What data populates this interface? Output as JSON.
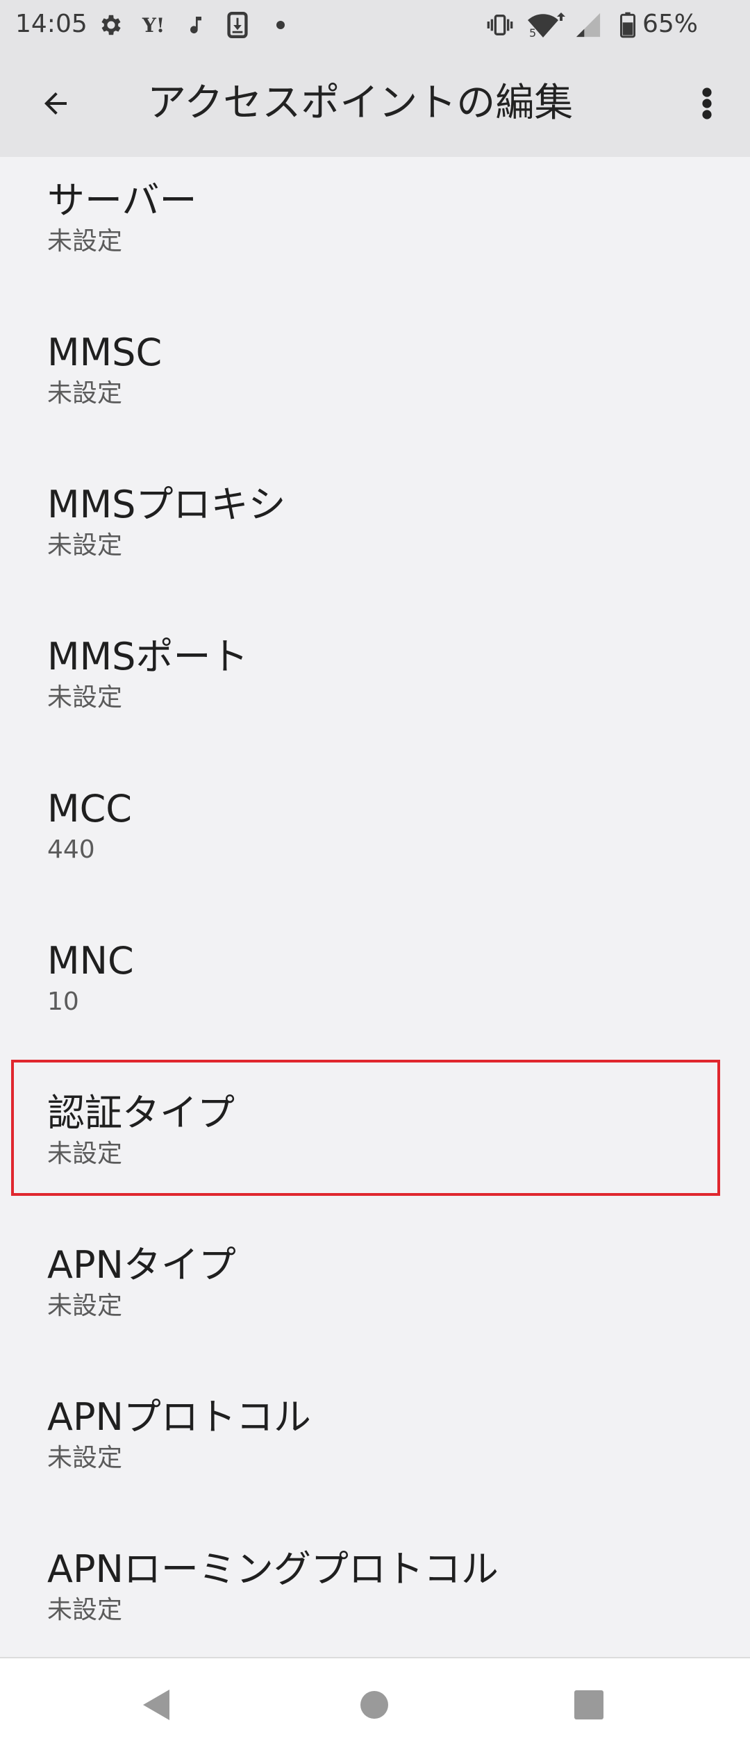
{
  "status_bar": {
    "time": "14:05",
    "left_icons": [
      "gear-icon",
      "yahoo-icon",
      "music-note-icon",
      "download-icon",
      "dot-icon"
    ],
    "yahoo_text": "Y!",
    "right_icons": [
      "vibrate-icon",
      "wifi-icon",
      "signal-icon",
      "battery-icon"
    ],
    "wifi_badge": "5",
    "battery_percent": "65%"
  },
  "app_bar": {
    "title": "アクセスポイントの編集"
  },
  "items": [
    {
      "title": "サーバー",
      "value": "未設定"
    },
    {
      "title": "MMSC",
      "value": "未設定"
    },
    {
      "title": "MMSプロキシ",
      "value": "未設定"
    },
    {
      "title": "MMSポート",
      "value": "未設定"
    },
    {
      "title": "MCC",
      "value": "440"
    },
    {
      "title": "MNC",
      "value": "10"
    },
    {
      "title": "認証タイプ",
      "value": "未設定"
    },
    {
      "title": "APNタイプ",
      "value": "未設定"
    },
    {
      "title": "APNプロトコル",
      "value": "未設定"
    },
    {
      "title": "APNローミングプロトコル",
      "value": "未設定"
    }
  ],
  "colors": {
    "highlight": "#e0272e",
    "background": "#f2f2f4",
    "bar": "#e4e4e6"
  }
}
